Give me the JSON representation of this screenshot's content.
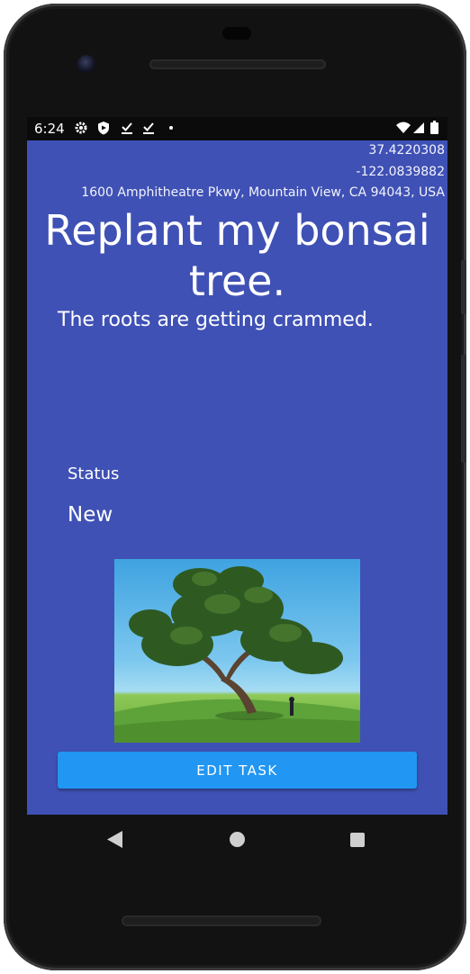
{
  "status_bar": {
    "time": "6:24",
    "icons_left": [
      "gear-icon",
      "shield-icon",
      "check-download-icon",
      "check-download-icon",
      "dot-icon"
    ],
    "icons_right": [
      "wifi-icon",
      "signal-icon",
      "battery-icon"
    ]
  },
  "location": {
    "latitude": "37.4220308",
    "longitude": "-122.0839882",
    "address": "1600 Amphitheatre Pkwy, Mountain View, CA 94043, USA"
  },
  "task": {
    "title": "Replant my bonsai tree.",
    "description": "The roots are getting crammed.",
    "status_label": "Status",
    "status_value": "New",
    "image_subject": "large tree on grassy hill under blue sky"
  },
  "actions": {
    "edit_label": "EDIT TASK"
  },
  "nav_bar": {
    "back_icon": "back-triangle-icon",
    "home_icon": "home-circle-icon",
    "recents_icon": "recents-square-icon"
  },
  "colors": {
    "app_background": "#3f51b5",
    "button": "#2196f3",
    "status_bar": "#0b0b0b",
    "device_frame": "#121212"
  }
}
